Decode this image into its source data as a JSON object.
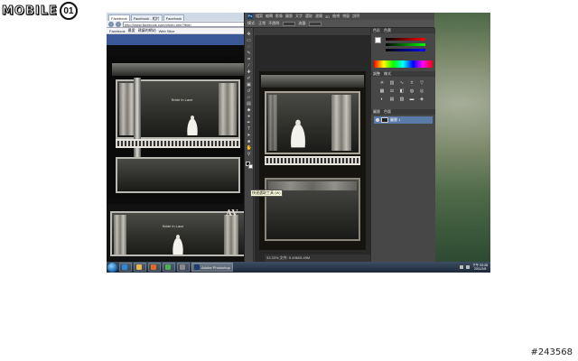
{
  "watermark": {
    "logo_text": "MOBILE",
    "logo_mark": "01",
    "ref_id": "#243568"
  },
  "browser": {
    "tabs": [
      "Facebook",
      "Facebook - 相片",
      "Facebook"
    ],
    "url": "http://www.facebook.com/photo.php?fbid=",
    "bookmarks": [
      "Facebook",
      "最愛",
      "建議的網站",
      "Web Slice",
      "收藏夾"
    ],
    "photo_caption": "Bride in Lace",
    "thumb_caption": "Bride in Lace",
    "watermark_initials": "AV"
  },
  "photoshop": {
    "logo": "Ps",
    "menus": [
      "檔案",
      "編輯",
      "影像",
      "圖層",
      "文字",
      "選取",
      "濾鏡",
      "3D",
      "檢視",
      "視窗",
      "說明"
    ],
    "options": [
      "模式:",
      "正常",
      "不透明:",
      "流量:"
    ],
    "document_tab": "P0001.jpg @ 33.3% (圖層 1, RGB/8)",
    "status": "33.33%   文件: 5.49M/5.49M",
    "tooltip": "快速選取工具 (W)",
    "panels": {
      "color_tab": "色彩",
      "swatch_tab": "色票",
      "adjust_tab": "調整",
      "style_tab": "樣式",
      "layers_tab": "圖層",
      "channels_tab": "色版",
      "layer_name": "圖層 1"
    }
  },
  "taskbar": {
    "items": [
      {
        "label": "",
        "icon": "ie-icon",
        "color": "#2a8ad8"
      },
      {
        "label": "",
        "icon": "folder-icon",
        "color": "#e8b84a"
      },
      {
        "label": "",
        "icon": "media-icon",
        "color": "#e06b1f"
      },
      {
        "label": "",
        "icon": "chrome-icon",
        "color": "#4caf50"
      },
      {
        "label": "",
        "icon": "app-icon",
        "color": "#8a8a8a"
      },
      {
        "label": "Adobe Photoshop",
        "icon": "photoshop-icon",
        "color": "#1d3c6e"
      }
    ],
    "time": "下午 03:28",
    "date": "2011/2/8"
  }
}
